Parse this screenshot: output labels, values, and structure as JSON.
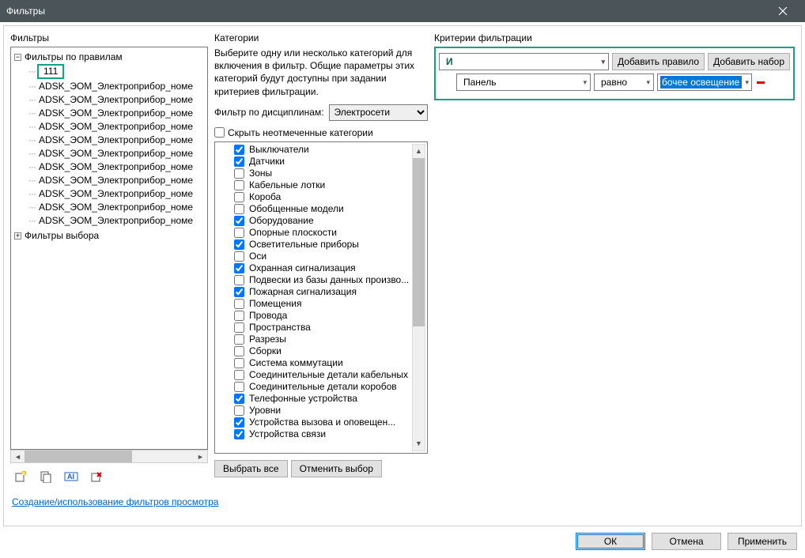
{
  "window": {
    "title": "Фильтры"
  },
  "left": {
    "label": "Фильтры",
    "root": "Фильтры по правилам",
    "highlighted": "111",
    "items": [
      "ADSK_ЭОМ_Электроприбор_номе",
      "ADSK_ЭОМ_Электроприбор_номе",
      "ADSK_ЭОМ_Электроприбор_номе",
      "ADSK_ЭОМ_Электроприбор_номе",
      "ADSK_ЭОМ_Электроприбор_номе",
      "ADSK_ЭОМ_Электроприбор_номе",
      "ADSK_ЭОМ_Электроприбор_номе",
      "ADSK_ЭОМ_Электроприбор_номе",
      "ADSK_ЭОМ_Электроприбор_номе",
      "ADSK_ЭОМ_Электроприбор_номе",
      "ADSK_ЭОМ_Электроприбор_номе"
    ],
    "root2": "Фильтры выбора"
  },
  "mid": {
    "label": "Категории",
    "desc": "Выберите одну или несколько категорий для включения в фильтр. Общие параметры этих категорий будут доступны при задании критериев фильтрации.",
    "discipline_label": "Фильтр по дисциплинам:",
    "discipline_value": "Электросети",
    "hide_label": "Скрыть неотмеченные категории",
    "categories": [
      {
        "label": "Выключатели",
        "checked": true
      },
      {
        "label": "Датчики",
        "checked": true
      },
      {
        "label": "Зоны",
        "checked": false
      },
      {
        "label": "Кабельные лотки",
        "checked": false
      },
      {
        "label": "Короба",
        "checked": false
      },
      {
        "label": "Обобщенные модели",
        "checked": false
      },
      {
        "label": "Оборудование",
        "checked": true
      },
      {
        "label": "Опорные плоскости",
        "checked": false
      },
      {
        "label": "Осветительные приборы",
        "checked": true
      },
      {
        "label": "Оси",
        "checked": false
      },
      {
        "label": "Охранная сигнализация",
        "checked": true
      },
      {
        "label": "Подвески из базы данных произво...",
        "checked": false
      },
      {
        "label": "Пожарная сигнализация",
        "checked": true
      },
      {
        "label": "Помещения",
        "checked": false
      },
      {
        "label": "Провода",
        "checked": false
      },
      {
        "label": "Пространства",
        "checked": false
      },
      {
        "label": "Разрезы",
        "checked": false
      },
      {
        "label": "Сборки",
        "checked": false
      },
      {
        "label": "Система коммутации",
        "checked": false
      },
      {
        "label": "Соединительные детали кабельных",
        "checked": false
      },
      {
        "label": "Соединительные детали коробов",
        "checked": false
      },
      {
        "label": "Телефонные устройства",
        "checked": true
      },
      {
        "label": "Уровни",
        "checked": false
      },
      {
        "label": "Устройства вызова и оповещен...",
        "checked": true
      },
      {
        "label": "Устройства связи",
        "checked": true
      }
    ],
    "select_all": "Выбрать все",
    "deselect_all": "Отменить выбор"
  },
  "right": {
    "label": "Критерии фильтрации",
    "and_label": "И",
    "add_rule": "Добавить правило",
    "add_set": "Добавить набор",
    "field": "Панель",
    "operator": "равно",
    "value": "бочее освещение"
  },
  "help_link": "Создание/использование фильтров просмотра",
  "footer": {
    "ok": "ОК",
    "cancel": "Отмена",
    "apply": "Применить"
  }
}
